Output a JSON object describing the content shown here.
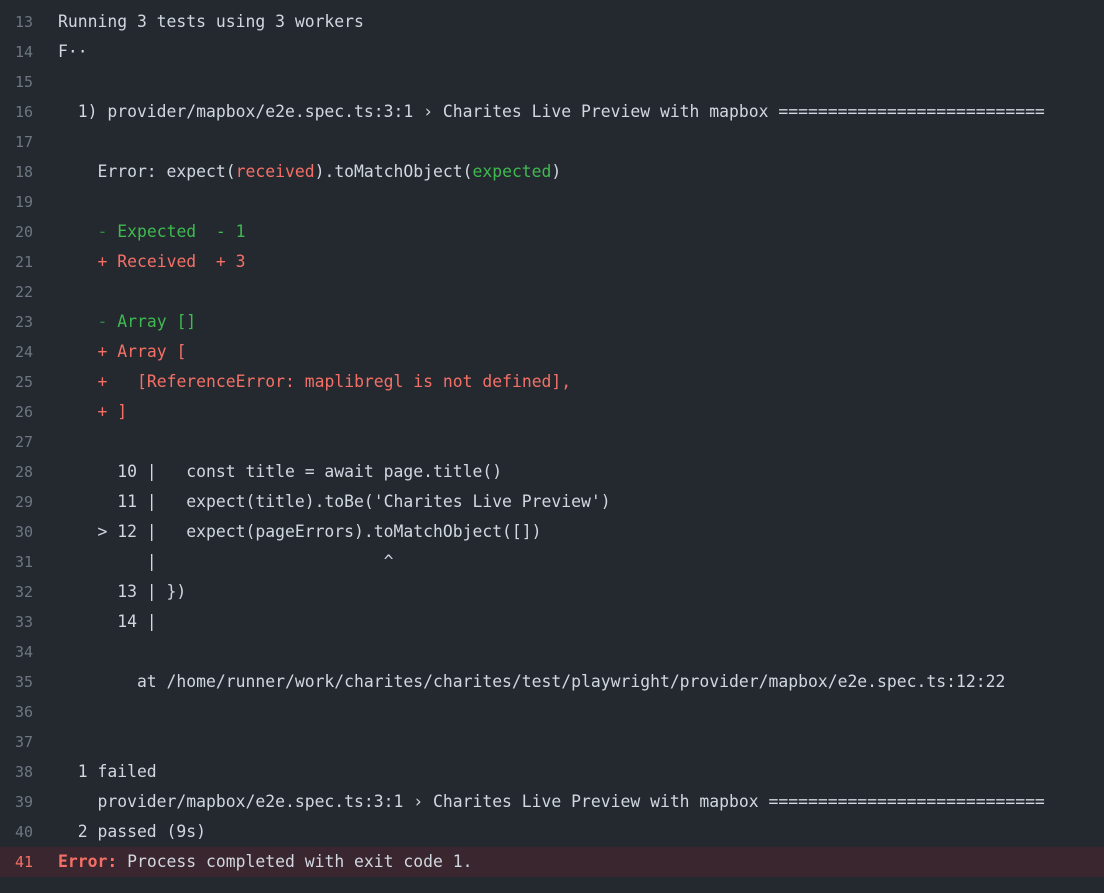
{
  "colors": {
    "background": "#24292f",
    "text": "#d1d7e0",
    "line_number": "#6e7681",
    "green": "#3fb950",
    "red": "#f47067",
    "error_row_bg": "#3a262e"
  },
  "lines": [
    {
      "n": "13",
      "text": "Running 3 tests using 3 workers"
    },
    {
      "n": "14",
      "text": "F··"
    },
    {
      "n": "15",
      "text": ""
    },
    {
      "n": "16",
      "text": "  1) provider/mapbox/e2e.spec.ts:3:1 › Charites Live Preview with mapbox ==========================="
    },
    {
      "n": "17",
      "text": ""
    },
    {
      "n": "18",
      "parts": {
        "a": "    Error: expect(",
        "b": "received",
        "c": ").toMatchObject(",
        "d": "expected",
        "e": ")"
      }
    },
    {
      "n": "19",
      "text": ""
    },
    {
      "n": "20",
      "parts": {
        "indent": "    ",
        "sign": "- ",
        "text": "Expected  - 1"
      }
    },
    {
      "n": "21",
      "parts": {
        "indent": "    ",
        "sign": "+ ",
        "text": "Received  + 3"
      }
    },
    {
      "n": "22",
      "text": ""
    },
    {
      "n": "23",
      "parts": {
        "indent": "    ",
        "sign": "- ",
        "text": "Array []"
      }
    },
    {
      "n": "24",
      "parts": {
        "indent": "    ",
        "sign": "+ ",
        "text": "Array ["
      }
    },
    {
      "n": "25",
      "parts": {
        "indent": "    ",
        "sign": "+   ",
        "text": "[ReferenceError: maplibregl is not defined],"
      }
    },
    {
      "n": "26",
      "parts": {
        "indent": "    ",
        "sign": "+ ",
        "text": "]"
      }
    },
    {
      "n": "27",
      "text": ""
    },
    {
      "n": "28",
      "text": "      10 |   const title = await page.title()"
    },
    {
      "n": "29",
      "text": "      11 |   expect(title).toBe('Charites Live Preview')"
    },
    {
      "n": "30",
      "text": "    > 12 |   expect(pageErrors).toMatchObject([])"
    },
    {
      "n": "31",
      "text": "         |                       ^"
    },
    {
      "n": "32",
      "text": "      13 | })"
    },
    {
      "n": "33",
      "text": "      14 |"
    },
    {
      "n": "34",
      "text": ""
    },
    {
      "n": "35",
      "text": "        at /home/runner/work/charites/charites/test/playwright/provider/mapbox/e2e.spec.ts:12:22"
    },
    {
      "n": "36",
      "text": ""
    },
    {
      "n": "37",
      "text": ""
    },
    {
      "n": "38",
      "text": "  1 failed"
    },
    {
      "n": "39",
      "text": "    provider/mapbox/e2e.spec.ts:3:1 › Charites Live Preview with mapbox ============================"
    },
    {
      "n": "40",
      "text": "  2 passed (9s)"
    },
    {
      "n": "41",
      "parts": {
        "label": "Error:",
        "text": " Process completed with exit code 1."
      }
    }
  ]
}
